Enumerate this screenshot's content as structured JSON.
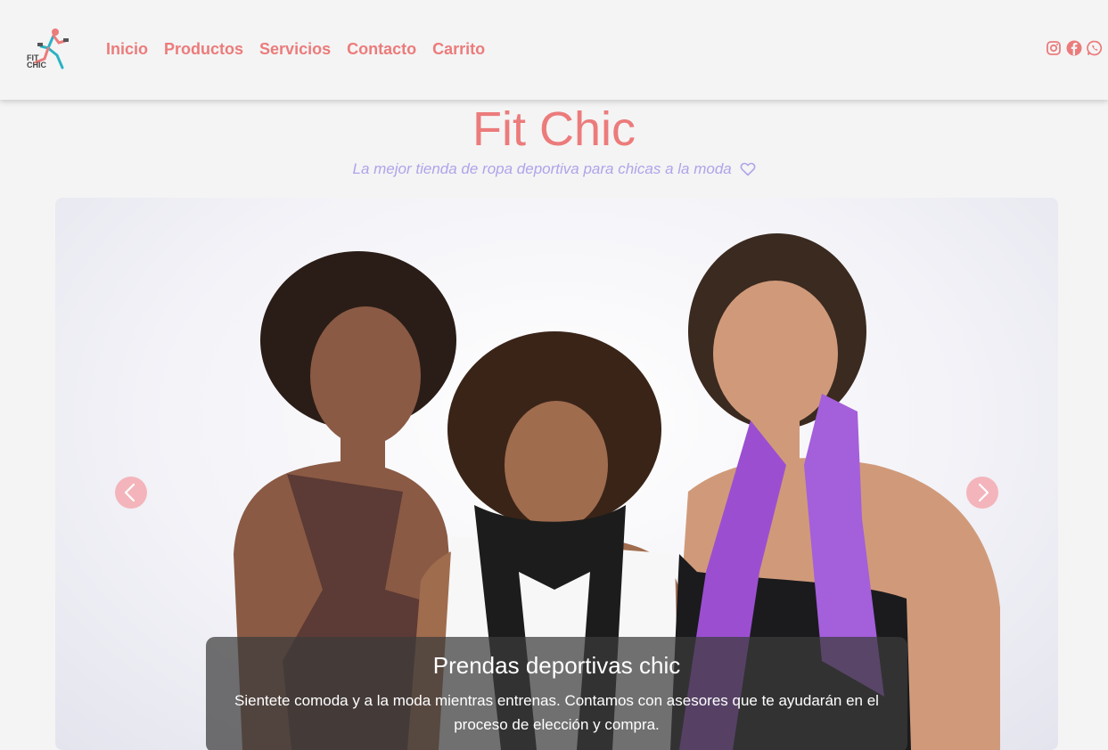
{
  "brand": {
    "logo_text": "FIT CHIC"
  },
  "nav": {
    "items": [
      {
        "label": "Inicio"
      },
      {
        "label": "Productos"
      },
      {
        "label": "Servicios"
      },
      {
        "label": "Contacto"
      },
      {
        "label": "Carrito"
      }
    ]
  },
  "social_icons": [
    "instagram-icon",
    "facebook-icon",
    "whatsapp-icon"
  ],
  "hero": {
    "title": "Fit Chic",
    "subtitle": "La mejor tienda de ropa deportiva para chicas a la moda"
  },
  "carousel": {
    "caption_title": "Prendas deportivas chic",
    "caption_text": "Sientete comoda y a la moda mientras entrenas. Contamos con asesores que te ayudarán en el proceso de elección y compra."
  },
  "colors": {
    "accent": "#ec7b7b",
    "subtitle": "#b0a3ea",
    "arrow_bg": "#f3b5bb",
    "background": "#f4f4f4"
  }
}
